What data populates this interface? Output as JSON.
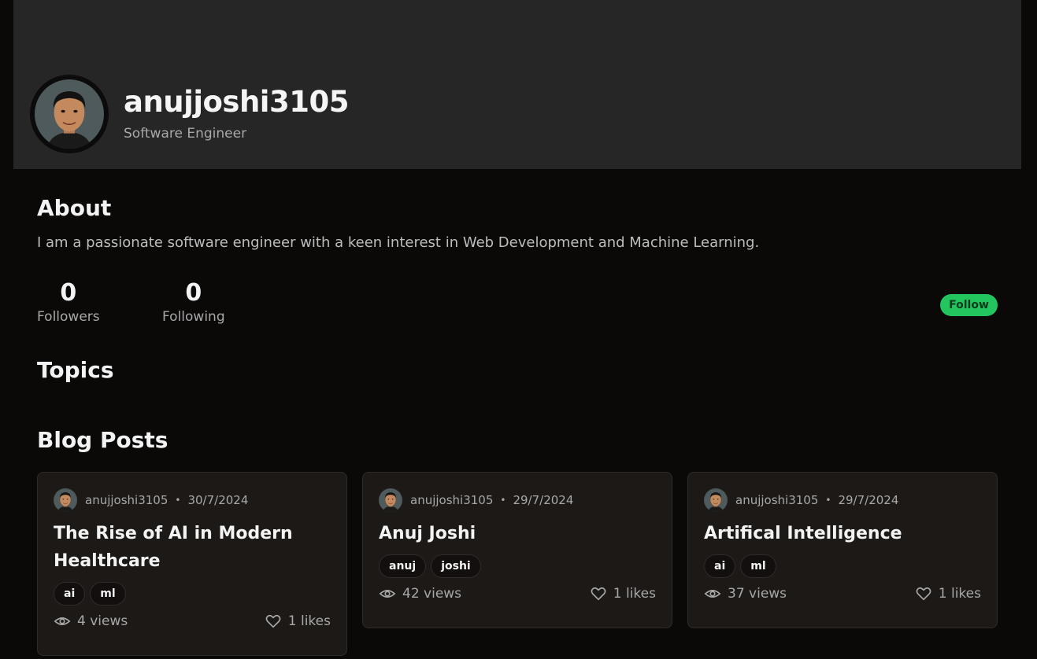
{
  "profile": {
    "username": "anujjoshi3105",
    "role": "Software Engineer"
  },
  "about": {
    "heading": "About",
    "text": "I am a passionate software engineer with a keen interest in Web Development and Machine Learning."
  },
  "stats": {
    "followers_count": "0",
    "followers_label": "Followers",
    "following_count": "0",
    "following_label": "Following"
  },
  "follow_button": "Follow",
  "topics_heading": "Topics",
  "blog_heading": "Blog Posts",
  "posts": [
    {
      "author": "anujjoshi3105",
      "date": "30/7/2024",
      "title": "The Rise of AI in Modern Healthcare",
      "tags": [
        "ai",
        "ml"
      ],
      "views": "4 views",
      "likes": "1 likes"
    },
    {
      "author": "anujjoshi3105",
      "date": "29/7/2024",
      "title": "Anuj Joshi",
      "tags": [
        "anuj",
        "joshi"
      ],
      "views": "42 views",
      "likes": "1 likes"
    },
    {
      "author": "anujjoshi3105",
      "date": "29/7/2024",
      "title": "Artifical Intelligence",
      "tags": [
        "ai",
        "ml"
      ],
      "views": "37 views",
      "likes": "1 likes"
    }
  ],
  "colors": {
    "header_bg": "#262626",
    "page_bg": "#0a0908",
    "card_bg": "#1c1917",
    "follow_button": "#22c55e"
  },
  "icons": {
    "views": "eye-icon",
    "likes": "heart-icon"
  }
}
